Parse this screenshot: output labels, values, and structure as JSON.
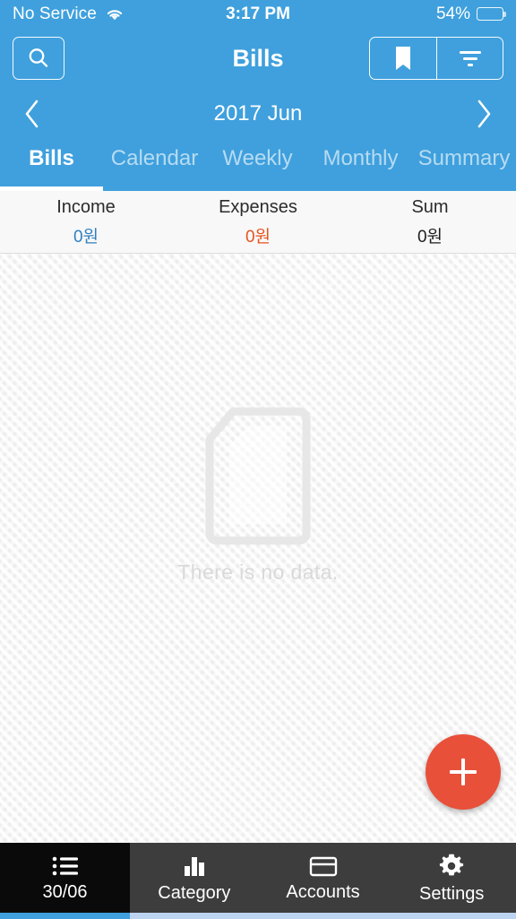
{
  "status_bar": {
    "carrier": "No Service",
    "wifi_icon": "wifi-icon",
    "time": "3:17 PM",
    "battery_percent": "54%",
    "battery_level": 54
  },
  "nav_bar": {
    "title": "Bills",
    "search_icon": "search-icon",
    "bookmark_icon": "bookmark-icon",
    "filter_icon": "filter-icon"
  },
  "month_nav": {
    "prev_icon": "chevron-left-icon",
    "label": "2017 Jun",
    "next_icon": "chevron-right-icon"
  },
  "tabs": {
    "active_index": 0,
    "items": [
      {
        "label": "Bills"
      },
      {
        "label": "Calendar"
      },
      {
        "label": "Weekly"
      },
      {
        "label": "Monthly"
      },
      {
        "label": "Summary"
      }
    ]
  },
  "summary": {
    "columns": [
      {
        "label": "Income",
        "value": "0원",
        "color": "#2f7fbf"
      },
      {
        "label": "Expenses",
        "value": "0원",
        "color": "#e8521e"
      },
      {
        "label": "Sum",
        "value": "0원",
        "color": "#1d1d1d"
      }
    ]
  },
  "content": {
    "empty_icon": "document-icon",
    "empty_text": "There is no data."
  },
  "fab": {
    "icon": "plus-icon",
    "color": "#e8503a"
  },
  "bottom_bar": {
    "active_index": 0,
    "items": [
      {
        "label": "30/06",
        "icon": "list-icon"
      },
      {
        "label": "Category",
        "icon": "bar-chart-icon"
      },
      {
        "label": "Accounts",
        "icon": "credit-card-icon"
      },
      {
        "label": "Settings",
        "icon": "gear-icon"
      }
    ]
  },
  "theme": {
    "accent_blue": "#3fa0dd",
    "tabbar_bg": "#3d3d3d",
    "tabbar_active_bg": "#0a0a0a"
  }
}
